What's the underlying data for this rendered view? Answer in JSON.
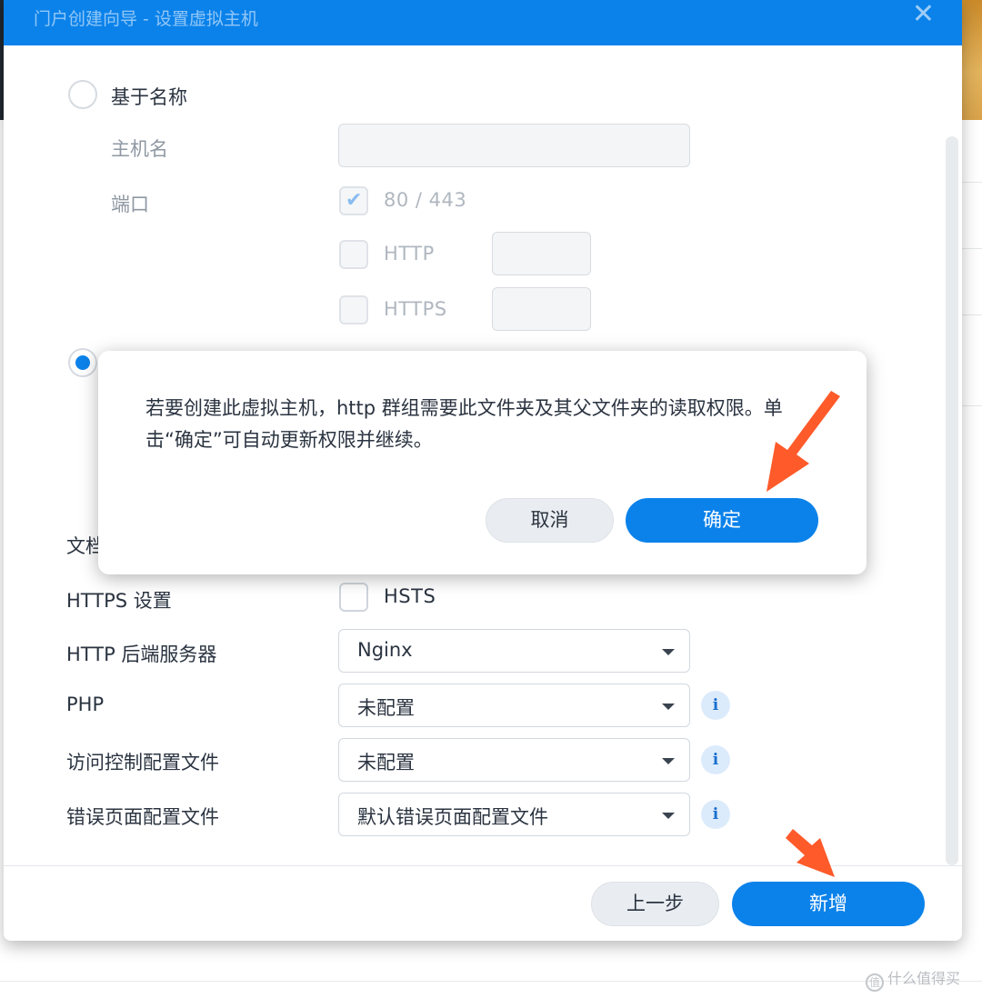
{
  "window": {
    "title": "门户创建向导 - 设置虚拟主机",
    "close_icon": "close-icon"
  },
  "form": {
    "name_based": {
      "label": "基于名称",
      "selected": false
    },
    "hostname": {
      "label": "主机名",
      "value": ""
    },
    "port": {
      "label": "端口",
      "default_ports": {
        "label": "80 / 443",
        "checked": true
      },
      "http": {
        "label": "HTTP",
        "checked": false,
        "value": ""
      },
      "https": {
        "label": "HTTPS",
        "checked": false,
        "value": ""
      }
    },
    "port_based": {
      "selected": true
    },
    "doc_root_partial_label": "文档",
    "https_settings": {
      "label": "HTTPS 设置",
      "hsts_label": "HSTS",
      "hsts_checked": false
    },
    "http_backend": {
      "label": "HTTP 后端服务器",
      "value": "Nginx"
    },
    "php": {
      "label": "PHP",
      "value": "未配置"
    },
    "access_control": {
      "label": "访问控制配置文件",
      "value": "未配置"
    },
    "error_page": {
      "label": "错误页面配置文件",
      "value": "默认错误页面配置文件"
    }
  },
  "footer": {
    "back_label": "上一步",
    "create_label": "新增"
  },
  "modal": {
    "message": "若要创建此虚拟主机，http 群组需要此文件夹及其父文件夹的读取权限。单击“确定”可自动更新权限并继续。",
    "cancel_label": "取消",
    "ok_label": "确定"
  },
  "watermark": {
    "icon": "值",
    "text": "什么值得买"
  },
  "colors": {
    "accent": "#0b82ea",
    "annotation_arrow": "#ff5a2a"
  }
}
